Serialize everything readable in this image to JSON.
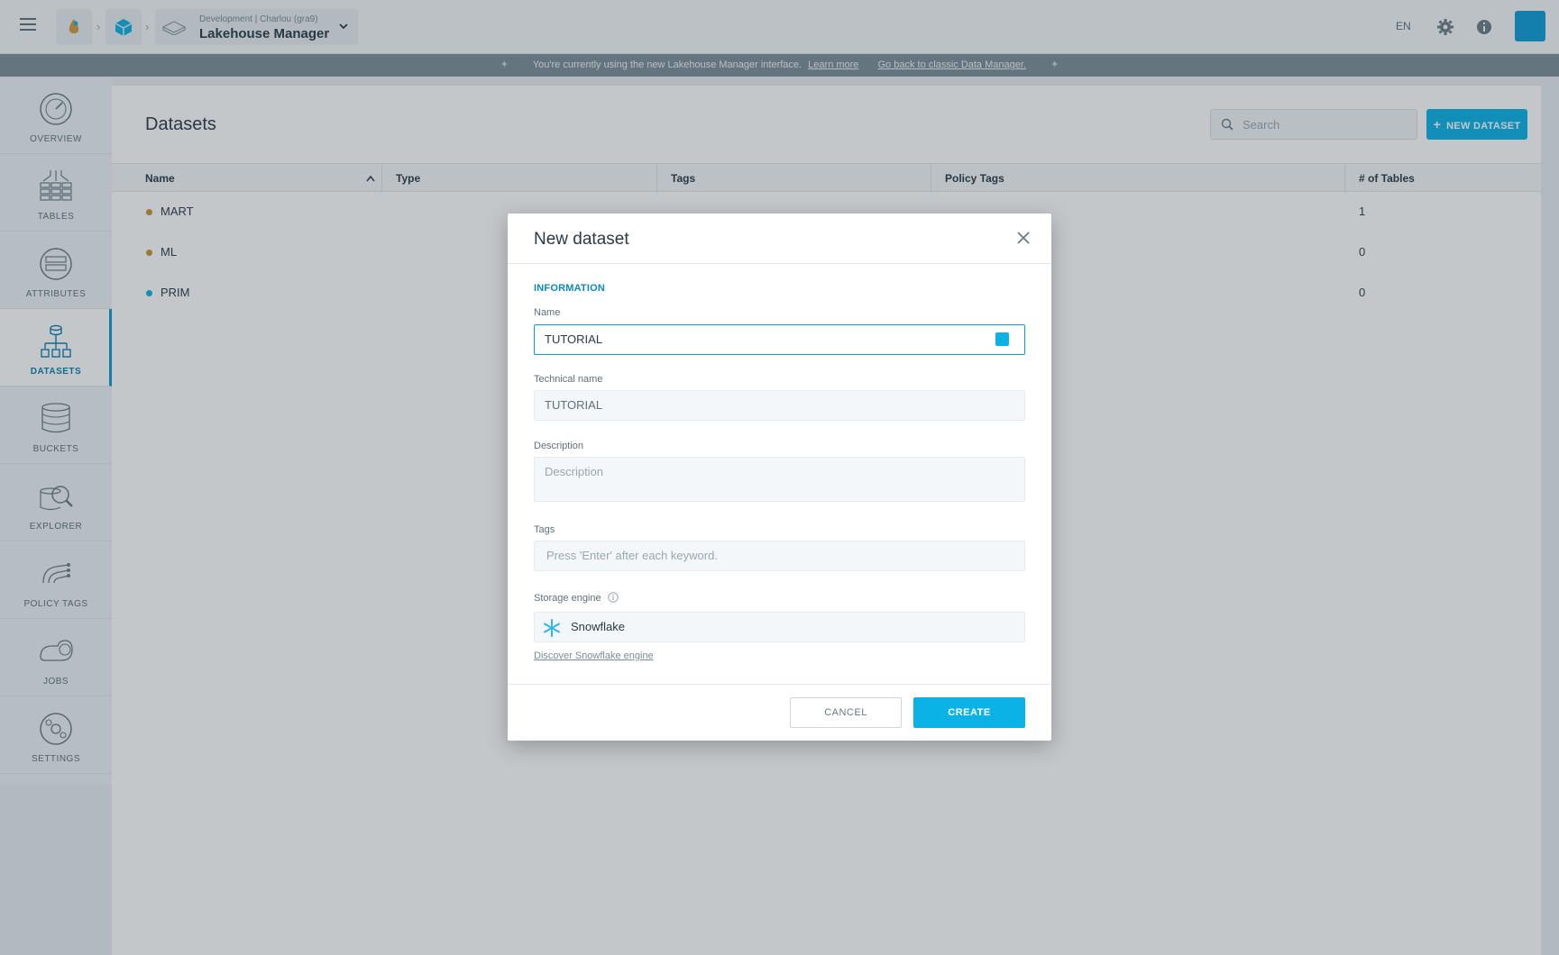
{
  "header": {
    "breadcrumb_sub": "Development  |  Charlou (gra9)",
    "app_name": "Lakehouse Manager",
    "lang": "EN",
    "colors": {
      "accent": "#0ab2e6",
      "user_tile": "#0e9bd4"
    }
  },
  "banner": {
    "text": "You're currently using the new Lakehouse Manager interface.",
    "learn_more": "Learn more",
    "go_back": "Go back to classic Data Manager."
  },
  "sidebar": {
    "items": [
      {
        "label": "OVERVIEW",
        "icon": "gauge-icon"
      },
      {
        "label": "TABLES",
        "icon": "tables-icon"
      },
      {
        "label": "ATTRIBUTES",
        "icon": "attributes-icon"
      },
      {
        "label": "DATASETS",
        "icon": "datasets-icon",
        "active": true
      },
      {
        "label": "BUCKETS",
        "icon": "buckets-icon"
      },
      {
        "label": "EXPLORER",
        "icon": "explorer-icon"
      },
      {
        "label": "POLICY TAGS",
        "icon": "policy-tags-icon"
      },
      {
        "label": "JOBS",
        "icon": "jobs-icon"
      },
      {
        "label": "SETTINGS",
        "icon": "settings-icon"
      }
    ]
  },
  "main": {
    "title": "Datasets",
    "search_placeholder": "Search",
    "new_button": "NEW DATASET",
    "columns": [
      "Name",
      "Type",
      "Tags",
      "Policy Tags",
      "# of Tables"
    ],
    "rows": [
      {
        "name": "MART",
        "tables": "1",
        "dot_color": "#c8922e"
      },
      {
        "name": "ML",
        "tables": "0",
        "dot_color": "#c8922e"
      },
      {
        "name": "PRIM",
        "tables": "0",
        "dot_color": "#0ab2e6"
      }
    ]
  },
  "modal": {
    "title": "New dataset",
    "section": "INFORMATION",
    "name_label": "Name",
    "name_value": "TUTORIAL",
    "technical_label": "Technical name",
    "technical_value": "TUTORIAL",
    "description_label": "Description",
    "description_placeholder": "Description",
    "tags_label": "Tags",
    "tags_placeholder": "Press 'Enter' after each keyword.",
    "storage_label": "Storage engine",
    "storage_value": "Snowflake",
    "discover_link": "Discover Snowflake engine",
    "cancel": "CANCEL",
    "create": "CREATE"
  }
}
